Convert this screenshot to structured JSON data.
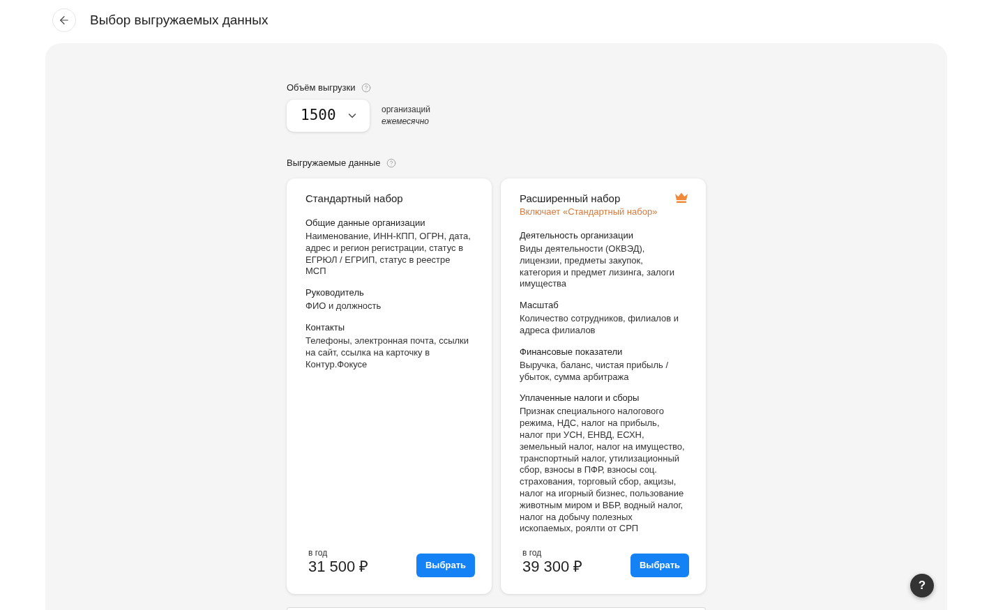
{
  "header": {
    "title": "Выбор выгружаемых данных"
  },
  "volume": {
    "label": "Объём выгрузки",
    "value": "1500",
    "unit": "организаций",
    "period": "ежемесячно"
  },
  "data_section": {
    "label": "Выгружаемые данные"
  },
  "plans": [
    {
      "title": "Стандартный набор",
      "premium": false,
      "sections": [
        {
          "heading": "Общие данные организации",
          "text": "Наименование, ИНН-КПП, ОГРН, дата, адрес и регион регистрации, статус в ЕГРЮЛ / ЕГРИП, статус в реестре МСП"
        },
        {
          "heading": "Руководитель",
          "text": "ФИО и должность"
        },
        {
          "heading": "Контакты",
          "text": "Телефоны, электронная почта, ссылки на сайт, ссылка на карточку в Контур.Фокусе"
        }
      ],
      "price_label": "в год",
      "price": "31 500 ₽",
      "button": "Выбрать"
    },
    {
      "title": "Расширенный набор",
      "subtitle": "Включает «Стандартный набор»",
      "premium": true,
      "sections": [
        {
          "heading": "Деятельность организации",
          "text": "Виды деятельности (ОКВЭД), лицензии, предметы закупок, категория и предмет лизинга, залоги имущества"
        },
        {
          "heading": "Масштаб",
          "text": "Количество сотрудников, филиалов и адреса филиалов"
        },
        {
          "heading": "Финансовые показатели",
          "text": "Выручка, баланс, чистая прибыль / убыток, сумма арбитража"
        },
        {
          "heading": "Уплаченные налоги и сборы",
          "text": "Признак специального налогового режима, НДС, налог на прибыль, налог при УСН, ЕНВД, ЕСХН, земельный налог, налог на имущество, транспортный налог, утилизационный сбор, взносы в ПФР, взносы соц. страхования, торговый сбор, акцизы, налог на игорный бизнес, пользование животным миром и ВБР, водный налог, налог на добычу полезных ископаемых, роялти от СРП"
        }
      ],
      "price_label": "в год",
      "price": "39 300 ₽",
      "button": "Выбрать"
    }
  ],
  "help_button": {
    "label": "?"
  }
}
